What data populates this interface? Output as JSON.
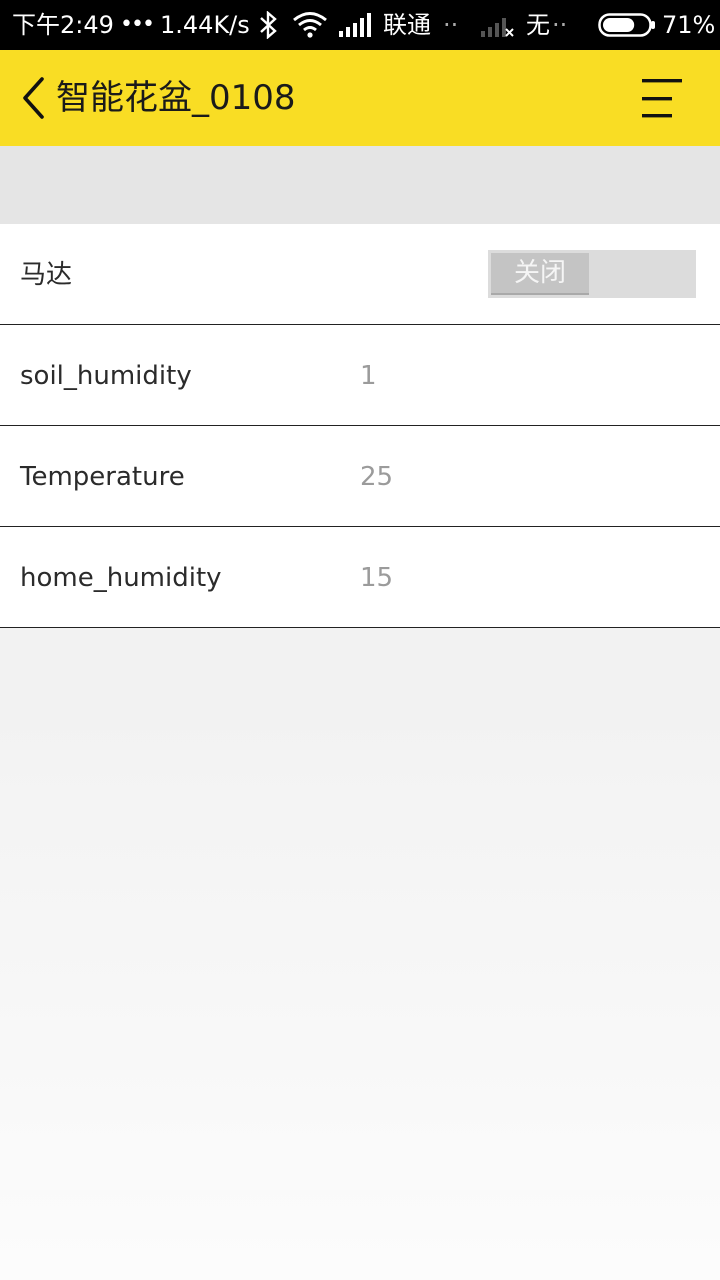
{
  "status_bar": {
    "time": "下午2:49",
    "dots": "•••",
    "speed": "1.44K/s",
    "carrier1": "联通",
    "dots2": "··",
    "carrier2": "无",
    "dots3": "··",
    "battery": "71%",
    "battery_level": 0.71,
    "icons": [
      "bluetooth-icon",
      "wifi-icon",
      "signal-icon",
      "signal-no-service-icon",
      "battery-icon"
    ]
  },
  "app_bar": {
    "title": "智能花盆_0108",
    "icons": [
      "back-chevron-icon",
      "menu-icon"
    ],
    "background": "#f9dd24"
  },
  "rows": [
    {
      "label": "马达",
      "toggle_label": "关闭",
      "toggle_on": false
    },
    {
      "label": "soil_humidity",
      "value": "1"
    },
    {
      "label": "Temperature",
      "value": "25"
    },
    {
      "label": "home_humidity",
      "value": "15"
    }
  ]
}
